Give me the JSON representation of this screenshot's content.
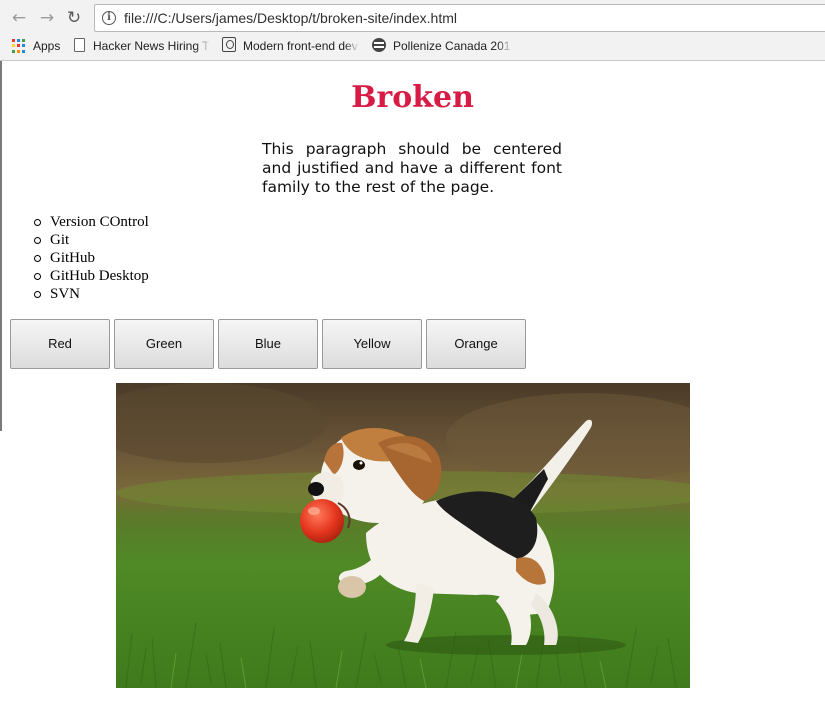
{
  "browser": {
    "url": "file:///C:/Users/james/Desktop/t/broken-site/index.html",
    "nav_icons": [
      "back-icon",
      "forward-icon",
      "reload-icon",
      "info-icon"
    ],
    "bookmarks": [
      {
        "label": "Apps",
        "icon": "apps-grid-icon"
      },
      {
        "label": "Hacker News Hiring T",
        "icon": "document-icon"
      },
      {
        "label": "Modern front-end dev",
        "icon": "lightbulb-icon"
      },
      {
        "label": "Pollenize Canada 201",
        "icon": "pollenize-icon"
      }
    ]
  },
  "page": {
    "title": "Broken",
    "title_color": "#d81b45",
    "paragraph": "This paragraph should be centered and justified and have a different font family to the rest of the page.",
    "list_items": [
      "Version COntrol",
      "Git",
      "GitHub",
      "GitHub Desktop",
      "SVN"
    ],
    "buttons": [
      "Red",
      "Green",
      "Blue",
      "Yellow",
      "Orange"
    ],
    "image": {
      "subject": "beagle puppy running on grass carrying a red ball"
    }
  }
}
